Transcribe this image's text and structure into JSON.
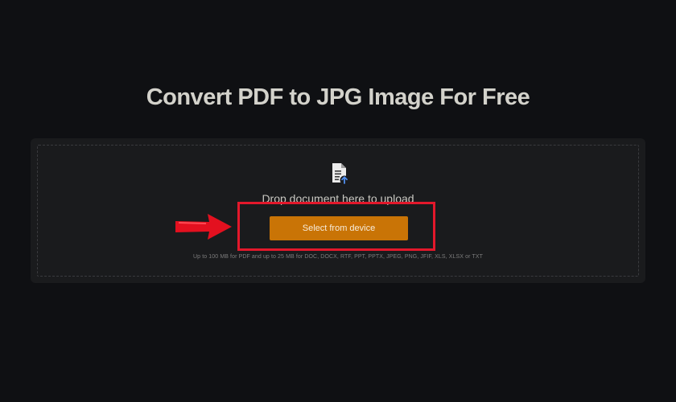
{
  "page": {
    "title": "Convert PDF to JPG Image For Free"
  },
  "upload": {
    "icon": "document-upload-icon",
    "drop_text": "Drop document here to upload",
    "select_label": "Select from device",
    "limits_note": "Up to 100 MB for PDF and up to 25 MB for DOC, DOCX, RTF, PPT, PPTX, JPEG, PNG, JFIF, XLS, XLSX or TXT"
  },
  "annotation": {
    "highlight_color": "#e3182b",
    "arrow_icon": "red-arrow-right-icon"
  },
  "colors": {
    "background": "#0f1013",
    "panel": "#1a1b1d",
    "accent": "#c97406",
    "title": "#d3d2cb"
  }
}
